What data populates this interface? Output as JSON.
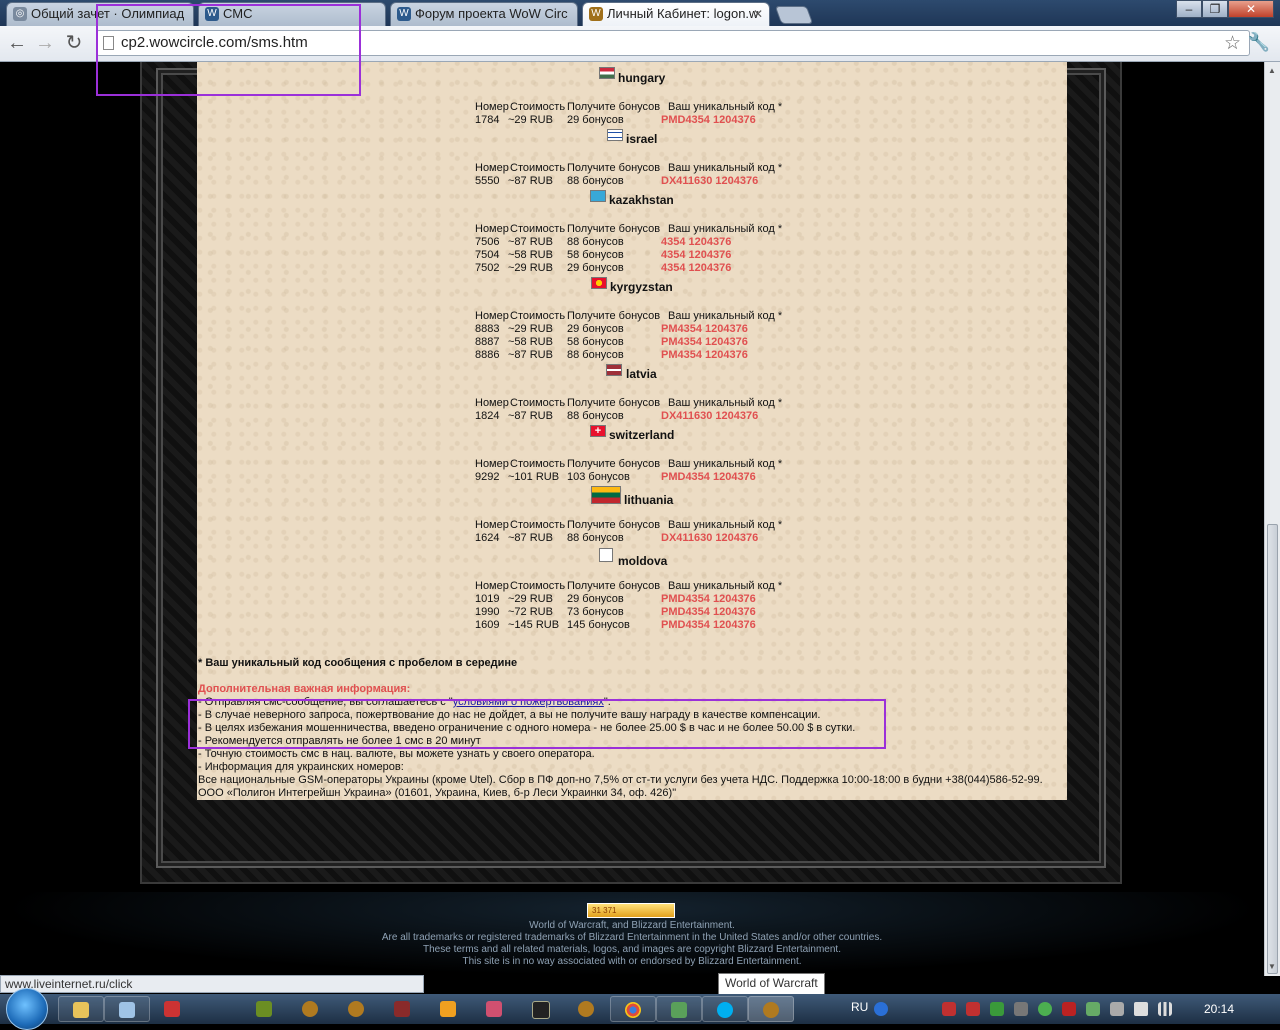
{
  "browser": {
    "tabs": [
      {
        "title": "Общий зачет · Олимпиад",
        "active": false
      },
      {
        "title": "СМС",
        "active": false
      },
      {
        "title": "Форум проекта WoW Circ",
        "active": false
      },
      {
        "title": "Личный Кабинет: logon.w",
        "active": true
      }
    ],
    "url": "cp2.wowcircle.com/sms.htm",
    "status_url": "www.liveinternet.ru/click",
    "tooltip": "World of Warcraft"
  },
  "sms_headers": {
    "number": "Номер",
    "cost": "Стоимость",
    "bonus": "Получите бонусов",
    "code": "Ваш уникальный код *"
  },
  "countries": [
    {
      "name": "hungary",
      "rows": []
    },
    {
      "name": "israel",
      "rows": [
        {
          "number": "1784",
          "cost": "~29 RUB",
          "bonus": "29 бонусов",
          "code": "PMD4354 1204376"
        }
      ]
    },
    {
      "name": "kazakhstan",
      "rows": [
        {
          "number": "5550",
          "cost": "~87 RUB",
          "bonus": "88 бонусов",
          "code": "DX411630 1204376"
        }
      ]
    },
    {
      "name": "kyrgyzstan",
      "rows": [
        {
          "number": "7506",
          "cost": "~87 RUB",
          "bonus": "88 бонусов",
          "code": "4354 1204376"
        },
        {
          "number": "7504",
          "cost": "~58 RUB",
          "bonus": "58 бонусов",
          "code": "4354 1204376"
        },
        {
          "number": "7502",
          "cost": "~29 RUB",
          "bonus": "29 бонусов",
          "code": "4354 1204376"
        }
      ]
    },
    {
      "name": "latvia",
      "rows": [
        {
          "number": "8883",
          "cost": "~29 RUB",
          "bonus": "29 бонусов",
          "code": "PM4354 1204376"
        },
        {
          "number": "8887",
          "cost": "~58 RUB",
          "bonus": "58 бонусов",
          "code": "PM4354 1204376"
        },
        {
          "number": "8886",
          "cost": "~87 RUB",
          "bonus": "88 бонусов",
          "code": "PM4354 1204376"
        }
      ]
    },
    {
      "name": "switzerland",
      "rows": [
        {
          "number": "1824",
          "cost": "~87 RUB",
          "bonus": "88 бонусов",
          "code": "DX411630 1204376"
        }
      ]
    },
    {
      "name": "lithuania",
      "rows": [
        {
          "number": "9292",
          "cost": "~101 RUB",
          "bonus": "103 бонусов",
          "code": "PMD4354 1204376"
        }
      ]
    },
    {
      "name": "moldova",
      "rows": [
        {
          "number": "1624",
          "cost": "~87 RUB",
          "bonus": "88 бонусов",
          "code": "DX411630 1204376"
        }
      ]
    },
    {
      "name": "",
      "rows": [
        {
          "number": "1019",
          "cost": "~29 RUB",
          "bonus": "29 бонусов",
          "code": "PMD4354 1204376"
        },
        {
          "number": "1990",
          "cost": "~72 RUB",
          "bonus": "73 бонусов",
          "code": "PMD4354 1204376"
        },
        {
          "number": "1609",
          "cost": "~145 RUB",
          "bonus": "145 бонусов",
          "code": "PMD4354 1204376"
        }
      ]
    }
  ],
  "note": "* Ваш уникальный код сообщения с пробелом в середине",
  "info": {
    "title": "Дополнительная важная информация:",
    "line1_prefix": "- Отправляя смс-сообщение, вы соглашаетесь с \"",
    "line1_link": "условиями о пожертвованиях",
    "line1_suffix": "\".",
    "line2": "- В случае неверного запроса, пожертвование до нас не дойдет, а вы не получите вашу награду в качестве компенсации.",
    "line3": "- В целях избежания мошенничества, введено ограничение с одного номера - не более 25.00 $ в час и не более 50.00 $ в сутки.",
    "line4": "- Рекомендуется отправлять не более 1 смс в 20 минут",
    "line5": "- Точную стоимость смс в нац. валюте, вы можете узнать у своего оператора.",
    "line6": "- Информация для украинских номеров:",
    "line7": "Все национальные GSM-операторы Украины (кроме Utel). Сбор в ПФ доп-но 7,5% от ст-ти услуги без учета НДС. Поддержка 10:00-18:00 в будни +38(044)586-52-99.",
    "line8": "ООО «Полигон Интегрейшн Украина» (01601, Украина, Киев, б-р Леси Украинки 34, оф. 426)\""
  },
  "footer": {
    "counter": "31 371",
    "line1": "World of Warcraft, and Blizzard Entertainment.",
    "line2": "Are all trademarks or registered trademarks of Blizzard Entertainment in the United States and/or other countries.",
    "line3": "These terms and all related materials, logos, and images are copyright Blizzard Entertainment.",
    "line4": "This site is in no way associated with or endorsed by Blizzard Entertainment."
  },
  "taskbar": {
    "language": "RU",
    "clock": "20:14"
  },
  "colors": {
    "parchment": "#ecdcc4",
    "code_red": "#e05050",
    "highlight_purple": "#9b30d9",
    "info_title": "#e05050"
  }
}
